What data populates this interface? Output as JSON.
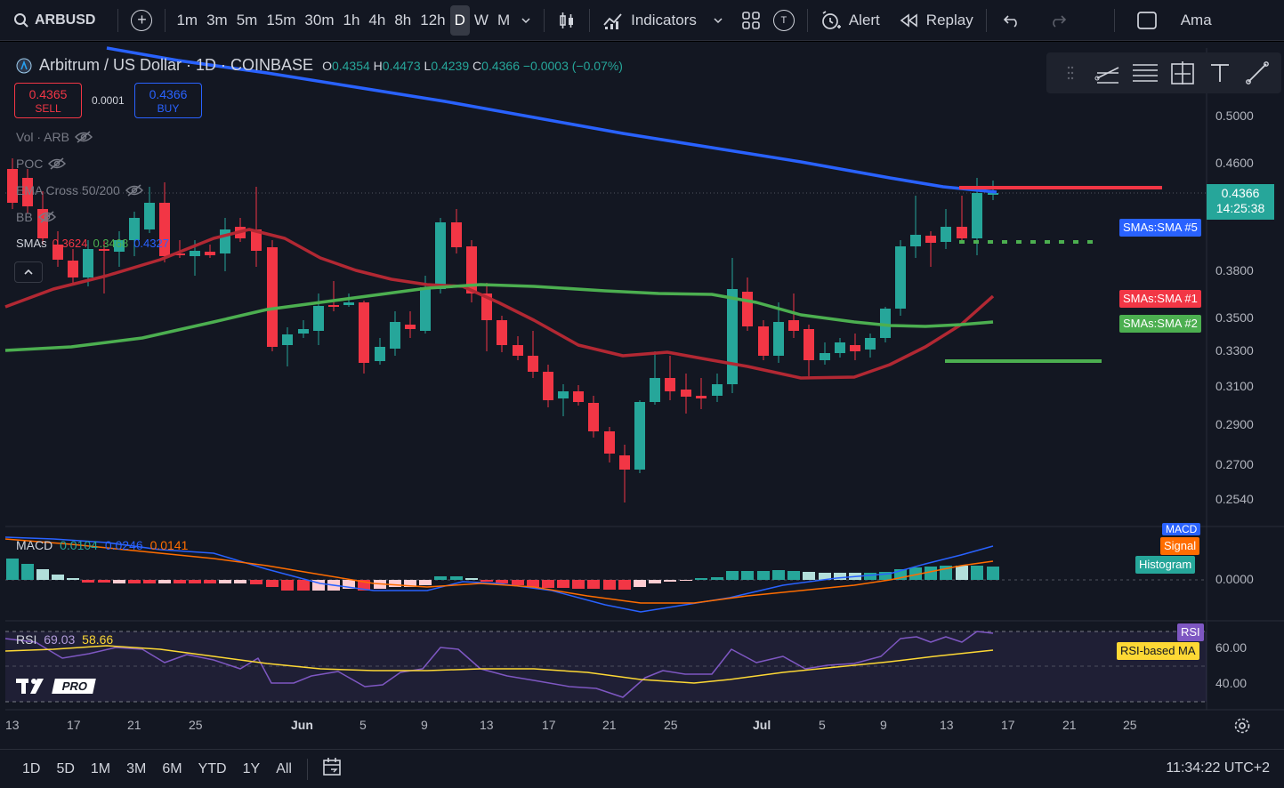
{
  "toolbar": {
    "symbol": "ARBUSD",
    "intervals": [
      "1m",
      "3m",
      "5m",
      "15m",
      "30m",
      "1h",
      "4h",
      "8h",
      "12h",
      "D",
      "W",
      "M"
    ],
    "active_interval": "D",
    "indicators_label": "Indicators",
    "alert_label": "Alert",
    "replay_label": "Replay",
    "t_badge": "T",
    "account_label": "Ama"
  },
  "legend": {
    "title": "Arbitrum / US Dollar · 1D · COINBASE",
    "open_label": "O",
    "open": "0.4354",
    "high_label": "H",
    "high": "0.4473",
    "low_label": "L",
    "low": "0.4239",
    "close_label": "C",
    "close": "0.4366",
    "change": "−0.0003 (−0.07%)"
  },
  "trade": {
    "sell_price": "0.4365",
    "sell_label": "SELL",
    "spread": "0.0001",
    "buy_price": "0.4366",
    "buy_label": "BUY"
  },
  "indicators": {
    "vol": "Vol · ARB",
    "poc": "POC",
    "ema_cross": "EMA Cross 50/200",
    "bb": "BB",
    "smas_label": "SMAs",
    "sma1": "0.3624",
    "sma2": "0.3468",
    "sma5": "0.4327"
  },
  "price_scale": {
    "labels": [
      "0.5000",
      "0.4600",
      "0.3800",
      "0.3500",
      "0.3300",
      "0.3100",
      "0.2900",
      "0.2700",
      "0.2540"
    ],
    "last_price": "0.4366",
    "countdown": "14:25:38",
    "tag_sma5": "SMAs:SMA #5",
    "tag_sma1": "SMAs:SMA #1",
    "tag_sma2": "SMAs:SMA #2"
  },
  "macd": {
    "label": "MACD",
    "v1": "0.0104",
    "v2": "0.0246",
    "v3": "0.0141",
    "tag_macd": "MACD",
    "tag_signal": "Signal",
    "tag_hist": "Histogram",
    "zero_label": "0.0000"
  },
  "rsi": {
    "label": "RSI",
    "v1": "69.03",
    "v2": "58.66",
    "tag_rsi": "RSI",
    "tag_ma": "RSI-based MA",
    "level_60": "60.00",
    "level_40": "40.00"
  },
  "time_axis": [
    "13",
    "17",
    "21",
    "25",
    "Jun",
    "5",
    "9",
    "13",
    "17",
    "21",
    "25",
    "Jul",
    "5",
    "9",
    "13",
    "17",
    "21",
    "25"
  ],
  "bottom": {
    "ranges": [
      "1D",
      "5D",
      "1M",
      "3M",
      "6M",
      "YTD",
      "1Y",
      "All"
    ],
    "clock": "11:34:22 UTC+2"
  },
  "logo_text": "PRO",
  "colors": {
    "bg": "#131722",
    "up": "#26a69a",
    "down": "#f23645",
    "sma5": "#2962ff",
    "sma1": "#b22833",
    "sma2": "#388e3c",
    "macd": "#2962ff",
    "signal": "#ff6d00",
    "rsi": "#7e57c2",
    "rsi_ma": "#fdd835"
  }
}
